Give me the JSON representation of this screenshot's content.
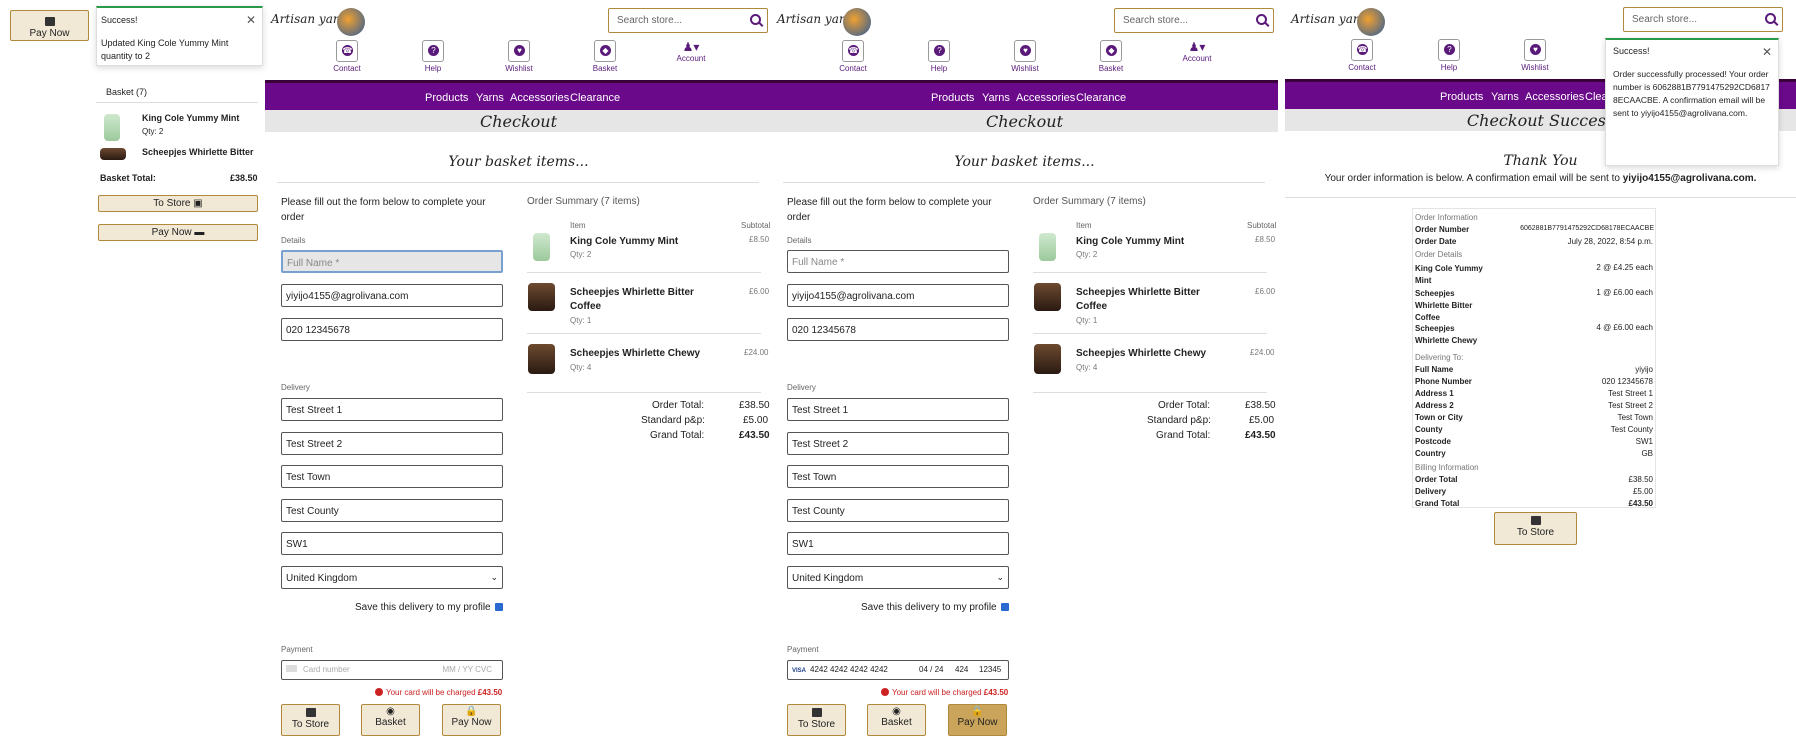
{
  "left": {
    "pay_now": "Pay Now",
    "toast_title": "Success!",
    "toast_msg": "Updated King Cole Yummy Mint quantity to 2",
    "basket_label": "Basket (7)",
    "item1_name": "King Cole Yummy Mint",
    "item1_qty": "Qty: 2",
    "item2_name": "Scheepjes Whirlette Bitter",
    "basket_total_label": "Basket Total:",
    "basket_total": "£38.50",
    "to_store": "To Store",
    "pay_now2": "Pay Now"
  },
  "header": {
    "logo": "Artisan yarns",
    "search_placeholder": "Search store...",
    "icons": [
      "Contact",
      "Help",
      "Wishlist",
      "Basket",
      "Account"
    ],
    "nav": [
      "Products",
      "Yarns",
      "Accessories",
      "Clearance"
    ]
  },
  "checkout": {
    "title": "Checkout",
    "basket_heading": "Your basket items...",
    "instructions": "Please fill out the form below to complete your order",
    "details_label": "Details",
    "full_name_ph": "Full Name *",
    "email": "yiyijo4155@agrolivana.com",
    "phone": "020 12345678",
    "delivery_label": "Delivery",
    "street1": "Test Street 1",
    "street2": "Test Street 2",
    "town": "Test Town",
    "county": "Test County",
    "postcode": "SW1",
    "country": "United Kingdom",
    "save_delivery": "Save this delivery to my profile",
    "payment_label": "Payment",
    "card_ph": "Card number",
    "card_exp_ph": "MM / YY  CVC",
    "card_filled": "4242 4242 4242 4242",
    "card_exp": "04 / 24",
    "card_cvc": "424",
    "card_zip": "12345",
    "card_brand": "VISA",
    "charge_text": "Your card will be charged",
    "charge_amount": "£43.50",
    "btn_store": "To Store",
    "btn_basket": "Basket",
    "btn_pay": "Pay Now",
    "summary_title": "Order Summary (7 items)",
    "col_item": "Item",
    "col_subtotal": "Subtotal",
    "items": [
      {
        "name": "King Cole Yummy Mint",
        "name2": "",
        "qty": "Qty: 2",
        "price": "£8.50"
      },
      {
        "name": "Scheepjes Whirlette Bitter",
        "name2": "Coffee",
        "qty": "Qty: 1",
        "price": "£6.00"
      },
      {
        "name": "Scheepjes Whirlette Chewy",
        "name2": "",
        "qty": "Qty: 4",
        "price": "£24.00"
      }
    ],
    "order_total_label": "Order Total:",
    "order_total": "£38.50",
    "pp_label": "Standard p&p:",
    "pp": "£5.00",
    "grand_label": "Grand Total:",
    "grand": "£43.50"
  },
  "success": {
    "title": "Checkout Success",
    "thank": "Thank You",
    "msg_pre": "Your order information is below. A confirmation email will be sent to",
    "msg_email": "yiyijo4155@agrolivana.com.",
    "toast_title": "Success!",
    "toast_msg": "Order successfully processed! Your order number is 6062881B7791475292CD68178ECAACBE. A confirmation email will be sent to yiyijo4155@agrolivana.com.",
    "sec_order": "Order Information",
    "order_number_label": "Order Number",
    "order_number": "6062881B7791475292CD68178ECAACBE",
    "order_date_label": "Order Date",
    "order_date": "July 28, 2022, 8:54 p.m.",
    "sec_details": "Order Details",
    "d1_name": "King Cole Yummy Mint",
    "d1_val": "2 @ £4.25 each",
    "d2_name": "Scheepjes Whirlette Bitter Coffee",
    "d2_val": "1 @ £6.00 each",
    "d3_name": "Scheepjes Whirlette Chewy",
    "d3_val": "4 @ £6.00 each",
    "sec_delivering": "Delivering To:",
    "full_name_label": "Full Name",
    "full_name": "yiyijo",
    "phone_label": "Phone Number",
    "phone": "020 12345678",
    "addr1_label": "Address 1",
    "addr1": "Test Street 1",
    "addr2_label": "Address 2",
    "addr2": "Test Street 2",
    "town_label": "Town or City",
    "town": "Test Town",
    "county_label": "County",
    "county": "Test County",
    "postcode_label": "Postcode",
    "postcode": "SW1",
    "country_label": "Country",
    "country": "GB",
    "sec_billing": "Billing Information",
    "ot_label": "Order Total",
    "ot": "£38.50",
    "del_label": "Delivery",
    "del": "£5.00",
    "gt_label": "Grand Total",
    "gt": "£43.50",
    "to_store": "To Store"
  }
}
